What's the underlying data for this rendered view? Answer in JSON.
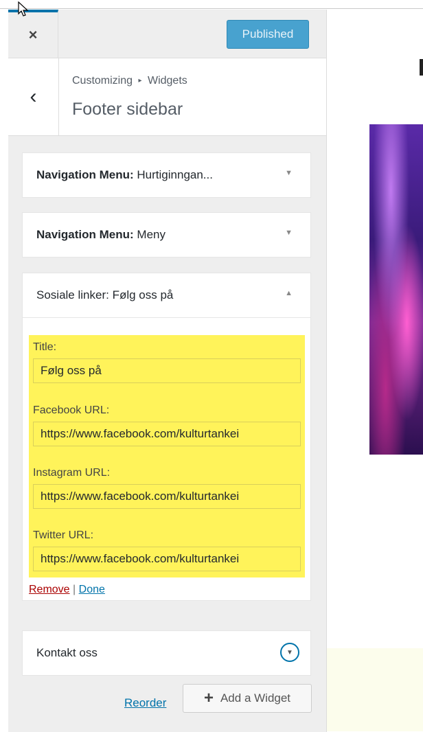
{
  "header": {
    "close_icon": "×",
    "published_label": "Published"
  },
  "section": {
    "back_icon": "‹",
    "breadcrumb_parent": "Customizing",
    "breadcrumb_sep": "▸",
    "breadcrumb_current": "Widgets",
    "title": "Footer sidebar"
  },
  "widgets": [
    {
      "type": "Navigation Menu:",
      "name": "Hurtiginngan...",
      "state": "collapsed"
    },
    {
      "type": "Navigation Menu:",
      "name": "Meny",
      "state": "collapsed"
    },
    {
      "type": "Sosiale linker:",
      "name": "Følg oss på",
      "state": "expanded"
    },
    {
      "type": "Kontakt oss",
      "name": "",
      "state": "collapsed"
    }
  ],
  "form": {
    "title_label": "Title:",
    "title_value": "Følg oss på",
    "facebook_label": "Facebook URL:",
    "facebook_value": "https://www.facebook.com/kulturtankei",
    "instagram_label": "Instagram URL:",
    "instagram_value": "https://www.facebook.com/kulturtankei",
    "twitter_label": "Twitter URL:",
    "twitter_value": "https://www.facebook.com/kulturtankei",
    "highlight_color": "#fff35a"
  },
  "actions": {
    "remove": "Remove",
    "separator": "|",
    "done": "Done"
  },
  "footer": {
    "reorder": "Reorder",
    "add_widget": "Add a Widget",
    "add_icon": "+"
  },
  "colors": {
    "accent": "#0073aa",
    "published_bg": "#48a2cf",
    "remove": "#aa0000"
  },
  "icons": {
    "collapsed_arrow": "▼",
    "expanded_arrow": "▲"
  }
}
